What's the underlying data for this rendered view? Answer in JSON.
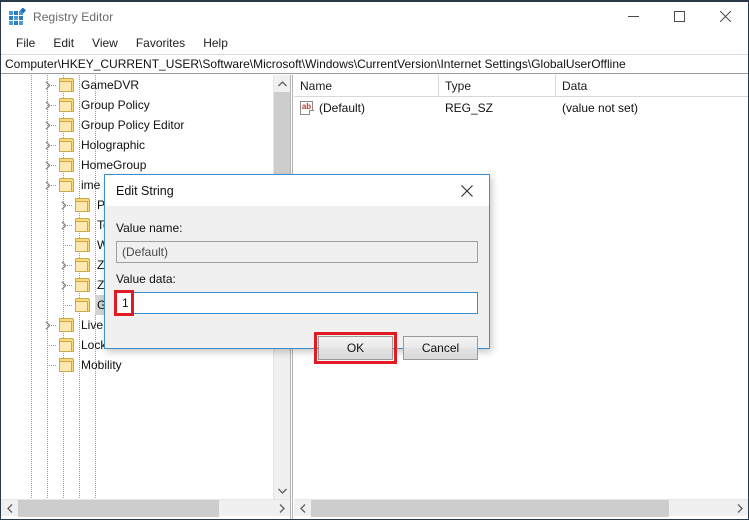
{
  "window": {
    "title": "Registry Editor",
    "icon": "registry-editor-icon",
    "controls": {
      "minimize": "minimize-icon",
      "maximize": "maximize-icon",
      "close": "close-icon"
    }
  },
  "menubar": {
    "items": [
      {
        "label": "File"
      },
      {
        "label": "Edit"
      },
      {
        "label": "View"
      },
      {
        "label": "Favorites"
      },
      {
        "label": "Help"
      }
    ]
  },
  "address": {
    "path": "Computer\\HKEY_CURRENT_USER\\Software\\Microsoft\\Windows\\CurrentVersion\\Internet Settings\\GlobalUserOffline"
  },
  "tree": {
    "nodes": [
      {
        "label": "GameDVR",
        "depth": 5,
        "expandable": true,
        "selected": false,
        "partial": false
      },
      {
        "label": "Group Policy",
        "depth": 5,
        "expandable": true,
        "selected": false,
        "partial": false
      },
      {
        "label": "Group Policy Editor",
        "depth": 5,
        "expandable": true,
        "selected": false,
        "partial": false
      },
      {
        "label": "Holographic",
        "depth": 5,
        "expandable": true,
        "selected": false,
        "partial": false
      },
      {
        "label": "HomeGroup",
        "depth": 5,
        "expandable": true,
        "selected": false,
        "partial": false
      },
      {
        "label": "ime",
        "depth": 5,
        "expandable": true,
        "selected": false,
        "partial": true
      },
      {
        "label": "Passport",
        "depth": 6,
        "expandable": true,
        "selected": false,
        "partial": false
      },
      {
        "label": "TemplatePolicies",
        "depth": 6,
        "expandable": true,
        "selected": false,
        "partial": false
      },
      {
        "label": "Wpad",
        "depth": 6,
        "expandable": false,
        "selected": false,
        "partial": false
      },
      {
        "label": "ZoneMap",
        "depth": 6,
        "expandable": true,
        "selected": false,
        "partial": false
      },
      {
        "label": "Zones",
        "depth": 6,
        "expandable": true,
        "selected": false,
        "partial": false
      },
      {
        "label": "GlobalUserOffline",
        "depth": 6,
        "expandable": false,
        "selected": true,
        "partial": false
      },
      {
        "label": "Live",
        "depth": 5,
        "expandable": true,
        "selected": false,
        "partial": false
      },
      {
        "label": "Lock Screen",
        "depth": 5,
        "expandable": false,
        "selected": false,
        "partial": false
      },
      {
        "label": "Mobility",
        "depth": 5,
        "expandable": false,
        "selected": false,
        "partial": true
      }
    ]
  },
  "values_list": {
    "columns": [
      "Name",
      "Type",
      "Data"
    ],
    "rows": [
      {
        "icon": "string-value-icon",
        "name": "(Default)",
        "type": "REG_SZ",
        "data": "(value not set)"
      }
    ]
  },
  "dialog": {
    "title": "Edit String",
    "close_icon": "close-icon",
    "value_name_label": "Value name:",
    "value_name": "(Default)",
    "value_data_label": "Value data:",
    "value_data": "1",
    "ok_label": "OK",
    "cancel_label": "Cancel",
    "highlight_color": "#e01b24"
  }
}
